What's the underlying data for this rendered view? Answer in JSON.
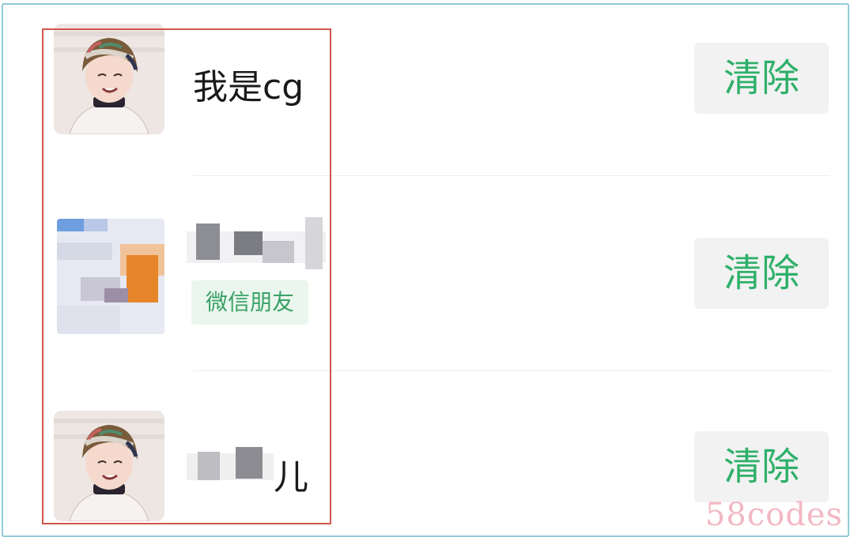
{
  "rows": [
    {
      "name": "我是cg",
      "tag": "",
      "clear_label": "清除"
    },
    {
      "name": "",
      "tag": "微信朋友",
      "clear_label": "清除"
    },
    {
      "name": "儿",
      "tag": "",
      "clear_label": "清除"
    }
  ],
  "watermark": "58codes",
  "colors": {
    "accent_green": "#2fb06a",
    "tag_bg": "#eaf6ee",
    "highlight_red": "#d2564a",
    "frame_border": "#8fcbd6"
  },
  "icons": {
    "avatar_1": "anime-avatar-icon",
    "avatar_2": "blurred-avatar-icon",
    "avatar_3": "anime-avatar-icon"
  }
}
